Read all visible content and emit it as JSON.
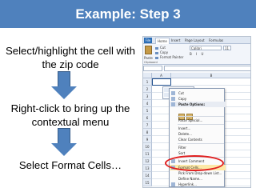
{
  "slide": {
    "title": "Example: Step 3",
    "steps": [
      {
        "text": "Select/highlight the cell with the zip code"
      },
      {
        "text": "Right-click to bring up the contextual menu"
      },
      {
        "text": "Select Format Cells…"
      }
    ],
    "accent_color": "#4f81bd",
    "highlight_color": "#e02020"
  },
  "excel": {
    "tabs": [
      "File",
      "Home",
      "Insert",
      "Page Layout",
      "Formulas"
    ],
    "clipboard": {
      "paste": "Paste",
      "items": [
        "Cut",
        "Copy",
        "Format Painter"
      ]
    },
    "font_name": "Calibri",
    "font_size": "11",
    "format_buttons": "B I U",
    "group_label": "Clipboard",
    "columns": [
      "A",
      "B"
    ],
    "rows": [
      "1",
      "2",
      "3",
      "4",
      "5",
      "6",
      "7",
      "8",
      "9",
      "10",
      "11",
      "12",
      "13",
      "14",
      "15"
    ],
    "menu": {
      "items": [
        "Cut",
        "Copy",
        "Paste Options:",
        "",
        "Paste Special...",
        "Insert...",
        "Delete...",
        "Clear Contents",
        "Filter",
        "Sort",
        "Insert Comment",
        "Format Cells...",
        "Pick From Drop-down List...",
        "Define Name...",
        "Hyperlink..."
      ]
    }
  }
}
